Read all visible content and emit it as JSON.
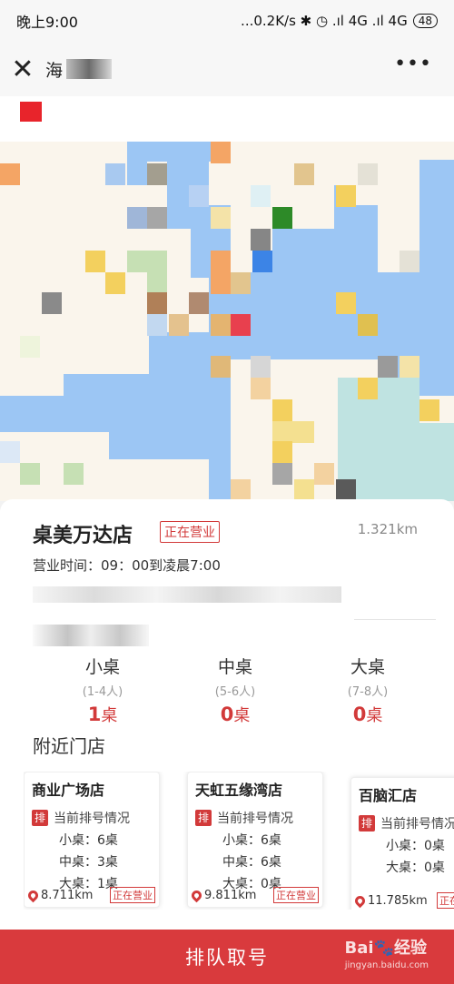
{
  "status_bar": {
    "time": "晚上9:00",
    "indicators": "...0.2K/s ✱ ◷ .ıl 4G .ıl 4G",
    "battery": "48"
  },
  "nav": {
    "title_prefix": "海",
    "more": "•••"
  },
  "store": {
    "name": "桌美万达店",
    "status": "正在营业",
    "distance": "1.321km",
    "hours": "营业时间：09：00到凌晨7:00"
  },
  "table_types": [
    {
      "name": "小桌",
      "range": "(1-4人)",
      "count": "1",
      "unit": "桌"
    },
    {
      "name": "中桌",
      "range": "(5-6人)",
      "count": "0",
      "unit": "桌"
    },
    {
      "name": "大桌",
      "range": "(7-8人)",
      "count": "0",
      "unit": "桌"
    }
  ],
  "nearby": {
    "title": "附近门店",
    "queue_icon": "排",
    "queue_label": "当前排号情况",
    "stores": [
      {
        "name": "商业广场店",
        "small": "小桌：6桌",
        "medium": "中桌：3桌",
        "large": "大桌：1桌",
        "distance": "8.711km",
        "status": "正在营业"
      },
      {
        "name": "天虹五缘湾店",
        "small": "小桌：6桌",
        "medium": "中桌：6桌",
        "large": "大桌：0桌",
        "distance": "9.811km",
        "status": "正在营业"
      },
      {
        "name": "百脑汇店",
        "small": "小桌：0桌",
        "medium": "大桌：0桌",
        "large": "",
        "distance": "11.785km",
        "status": "正在营业"
      }
    ]
  },
  "bottom": {
    "button": "排队取号",
    "watermark": "Bai🐾经验",
    "watermark_sub": "jingyan.baidu.com"
  }
}
